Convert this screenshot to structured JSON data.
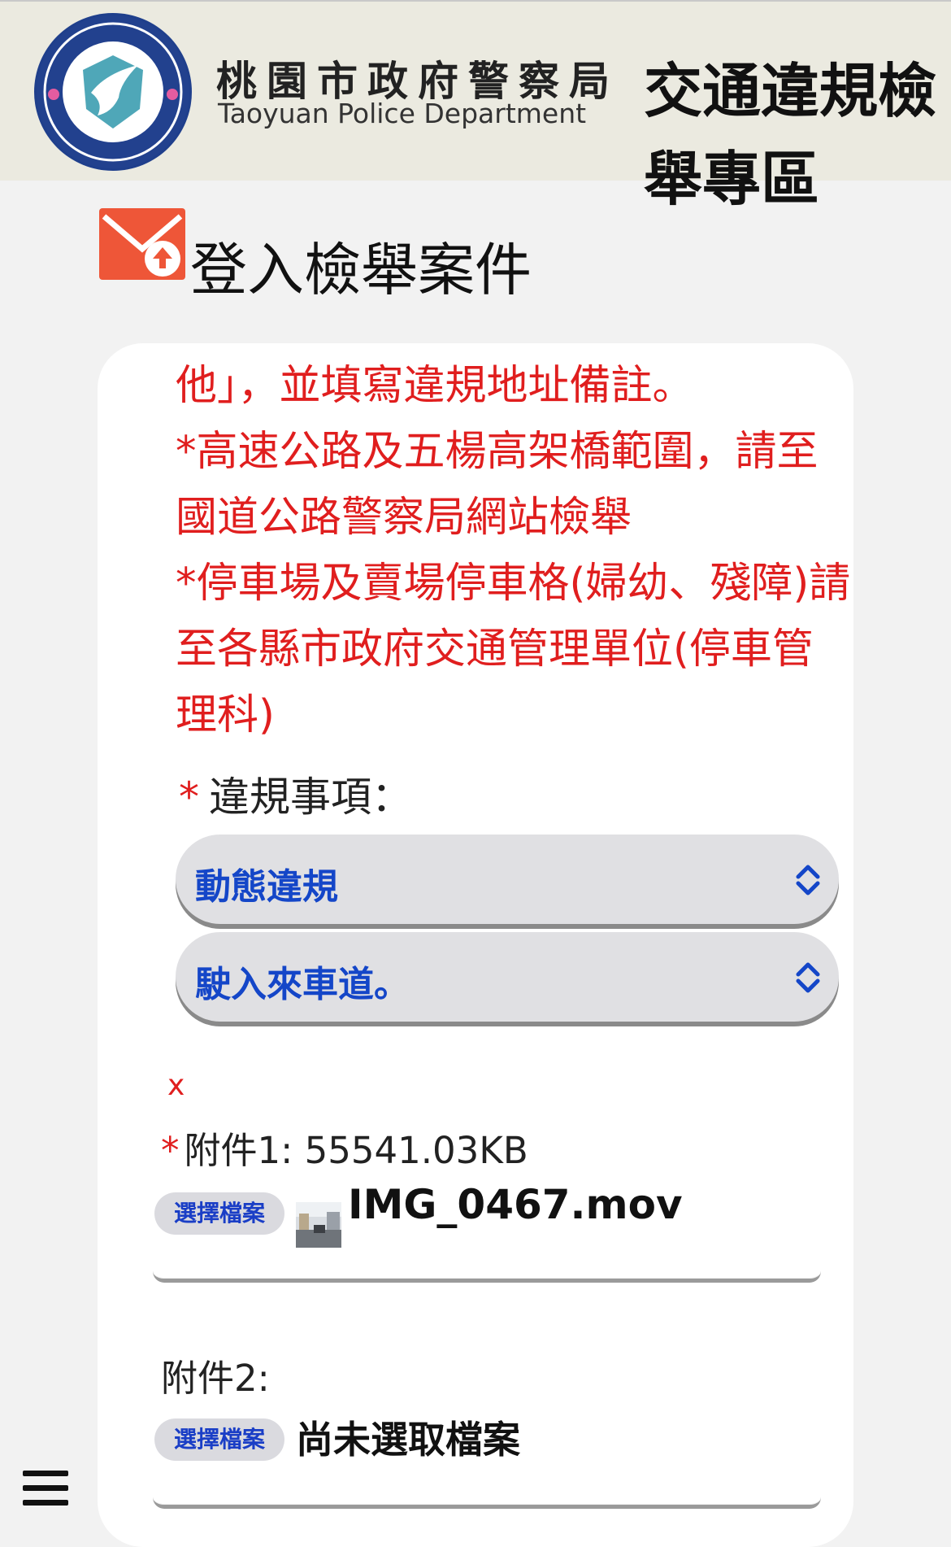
{
  "header": {
    "dept_name_cn": "桃園市政府警察局",
    "dept_name_en": "Taoyuan Police Department",
    "zone_title_line1": "交通違規檢",
    "zone_title_line2": "舉專區"
  },
  "section": {
    "title": "登入檢舉案件"
  },
  "notice_lines": [
    "他」，並填寫違規地址備註。",
    "*高速公路及五楊高架橋範圍，請至",
    "國道公路警察局網站檢舉",
    "*停車場及賣場停車格(婦幼、殘障)請",
    "至各縣市政府交通管理單位(停車管",
    "理科)"
  ],
  "violation": {
    "required_mark": "*",
    "label": "違規事項：",
    "category_selected": "動態違規",
    "item_selected": "駛入來車道。"
  },
  "attachments": [
    {
      "required_mark": "*",
      "label": "附件1: 55541.03KB",
      "button_label": "選擇檔案",
      "file_name": "IMG_0467.mov",
      "remove_label": "x"
    },
    {
      "label": "附件2:",
      "button_label": "選擇檔案",
      "file_name": "尚未選取檔案"
    }
  ],
  "colors": {
    "header_bg": "#ebeae0",
    "page_bg": "#f2f2f2",
    "notice_red": "#e01e1e",
    "select_text_blue": "#1446c8",
    "section_icon": "#ee5638"
  }
}
